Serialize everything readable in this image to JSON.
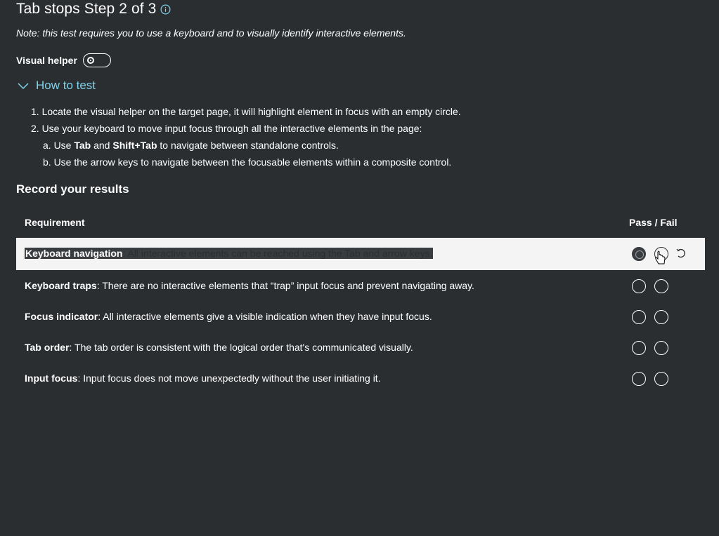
{
  "header": {
    "title": "Tab stops Step 2 of 3",
    "info_icon": "info-icon"
  },
  "note": "Note: this test requires you to use a keyboard and to visually identify interactive elements.",
  "visual_helper": {
    "label": "Visual helper",
    "state": "off"
  },
  "how_to_test": {
    "label": "How to test",
    "expanded": true,
    "steps": [
      "1. Locate the visual helper on the target page, it will highlight element in focus with an empty circle.",
      "2. Use your keyboard to move input focus through all the interactive elements in the page:"
    ],
    "substeps": {
      "a_prefix": "a. Use ",
      "a_key1": "Tab",
      "a_and": " and ",
      "a_key2": "Shift+Tab",
      "a_suffix": " to navigate between standalone controls.",
      "b": "b. Use the arrow keys to navigate between the focusable elements within a composite control."
    }
  },
  "results": {
    "title": "Record your results",
    "col_requirement": "Requirement",
    "col_passfail": "Pass / Fail",
    "rows": [
      {
        "name": "Keyboard navigation",
        "desc": ": All interactive elements can be reached using the Tab and arrow keys.",
        "selected": "pass"
      },
      {
        "name": "Keyboard traps",
        "desc": ": There are no interactive elements that “trap” input focus and prevent navigating away.",
        "selected": "none"
      },
      {
        "name": "Focus indicator",
        "desc": ": All interactive elements give a visible indication when they have input focus.",
        "selected": "none"
      },
      {
        "name": "Tab order",
        "desc": ": The tab order is consistent with the logical order that's communicated visually.",
        "selected": "none"
      },
      {
        "name": "Input focus",
        "desc": ": Input focus does not move unexpectedly without the user initiating it.",
        "selected": "none"
      }
    ]
  },
  "colors": {
    "background": "#2b2e31",
    "link": "#7fd3ec",
    "active_row": "#f4f4f4"
  }
}
